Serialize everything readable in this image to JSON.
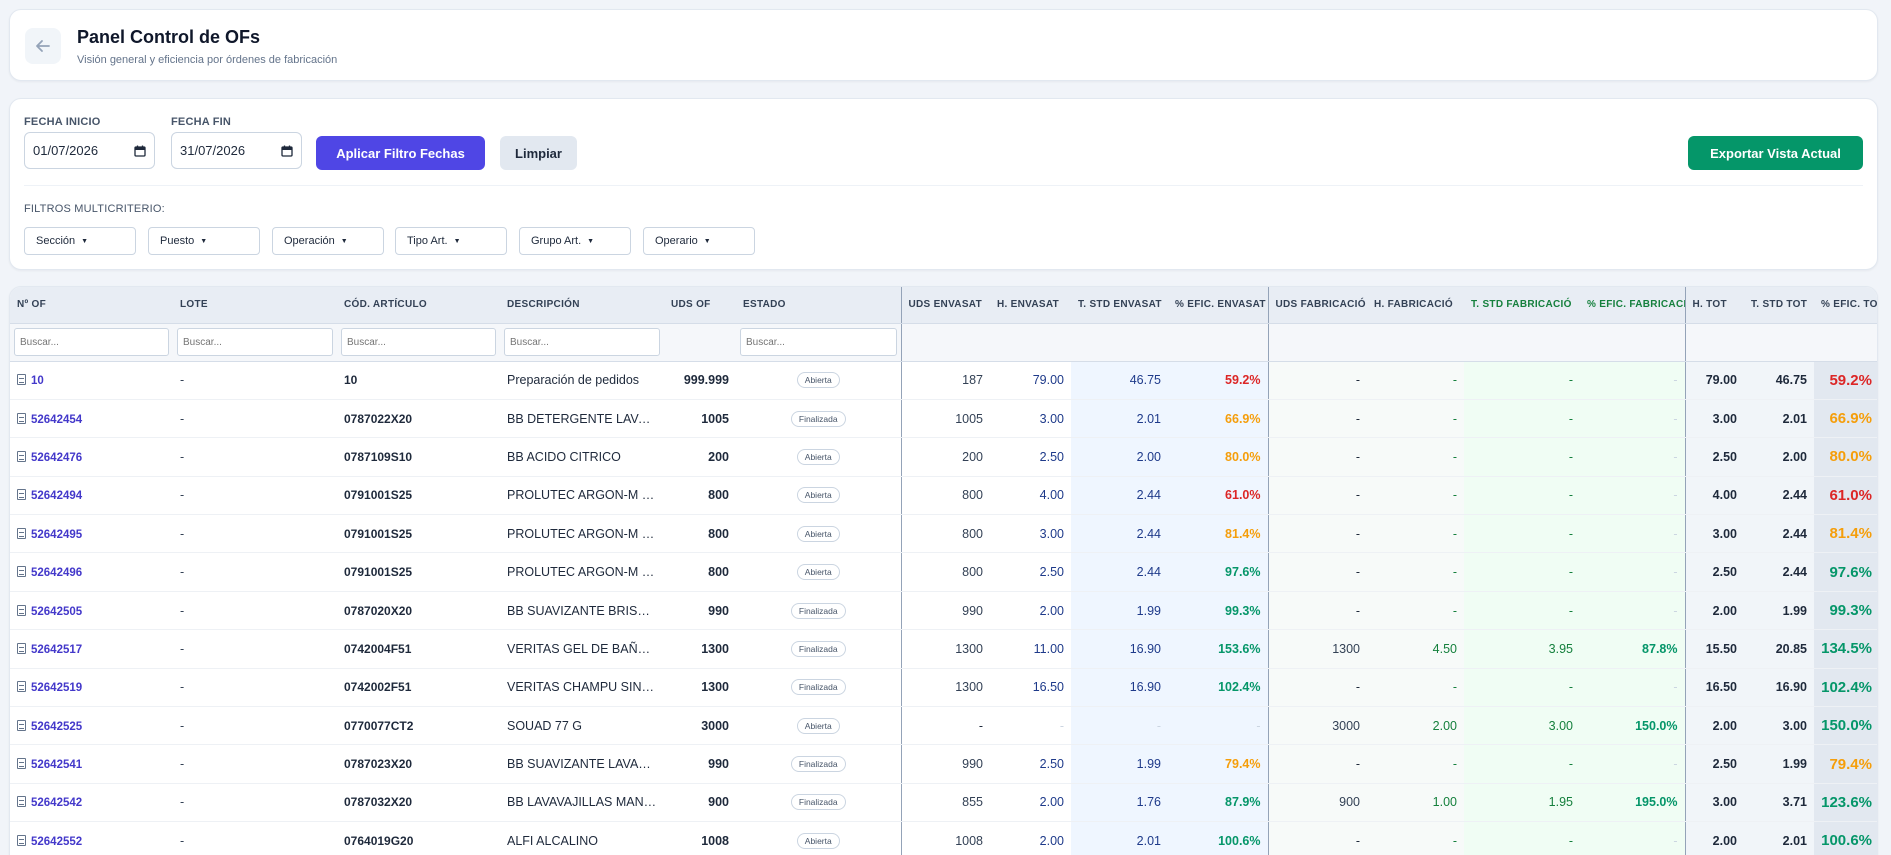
{
  "header": {
    "title": "Panel Control de OFs",
    "subtitle": "Visión general y eficiencia por órdenes de fabricación"
  },
  "filters": {
    "start_label": "FECHA INICIO",
    "start_value": "01/07/2026",
    "end_label": "FECHA FIN",
    "end_value": "31/07/2026",
    "apply_label": "Aplicar Filtro Fechas",
    "clear_label": "Limpiar",
    "export_label": "Exportar Vista Actual",
    "multi_label": "FILTROS MULTICRITERIO:",
    "dropdowns": [
      "Sección",
      "Puesto",
      "Operación",
      "Tipo Art.",
      "Grupo Art.",
      "Operario"
    ]
  },
  "colors": {
    "primary": "#4f46e5",
    "export": "#059669",
    "eff_low": "#dc2626",
    "eff_mid": "#f59e0b",
    "eff_high": "#059669"
  },
  "table": {
    "columns": [
      "Nº OF",
      "LOTE",
      "CÓD. ARTÍCULO",
      "DESCRIPCIÓN",
      "UDS OF",
      "ESTADO",
      "UDS ENVASAT",
      "H. ENVASAT",
      "T. STD ENVASAT",
      "% EFIC. ENVASAT",
      "UDS FABRICACIÓ",
      "H. FABRICACIÓ",
      "T. STD FABRICACIÓ",
      "% EFIC. FABRICACIÓ",
      "H. TOT",
      "T. STD TOT",
      "% EFIC. TOT"
    ],
    "search_placeholder": "Buscar...",
    "rows": [
      {
        "of": "10",
        "lote": "-",
        "cod": "10",
        "desc": "Preparación de pedidos",
        "uds": "999.999",
        "estado": "Abierta",
        "u_env": "187",
        "h_env": "79.00",
        "t_env": "46.75",
        "e_env": "59.2%",
        "e_env_lvl": "low",
        "u_fab": "-",
        "h_fab": "-",
        "t_fab": "-",
        "e_fab": "-",
        "e_fab_lvl": "none",
        "h_tot": "79.00",
        "t_tot": "46.75",
        "e_tot": "59.2%",
        "e_tot_lvl": "low"
      },
      {
        "of": "52642454",
        "lote": "-",
        "cod": "0787022X20",
        "desc": "BB DETERGENTE LAVADORA",
        "uds": "1005",
        "estado": "Finalizada",
        "u_env": "1005",
        "h_env": "3.00",
        "t_env": "2.01",
        "e_env": "66.9%",
        "e_env_lvl": "mid",
        "u_fab": "-",
        "h_fab": "-",
        "t_fab": "-",
        "e_fab": "-",
        "e_fab_lvl": "none",
        "h_tot": "3.00",
        "t_tot": "2.01",
        "e_tot": "66.9%",
        "e_tot_lvl": "mid"
      },
      {
        "of": "52642476",
        "lote": "-",
        "cod": "0787109S10",
        "desc": "BB ACIDO CITRICO",
        "uds": "200",
        "estado": "Abierta",
        "u_env": "200",
        "h_env": "2.50",
        "t_env": "2.00",
        "e_env": "80.0%",
        "e_env_lvl": "mid",
        "u_fab": "-",
        "h_fab": "-",
        "t_fab": "-",
        "e_fab": "-",
        "e_fab_lvl": "none",
        "h_tot": "2.50",
        "t_tot": "2.00",
        "e_tot": "80.0%",
        "e_tot_lvl": "mid"
      },
      {
        "of": "52642494",
        "lote": "-",
        "cod": "0791001S25",
        "desc": "PROLUTEC ARGON-M JABON",
        "uds": "800",
        "estado": "Abierta",
        "u_env": "800",
        "h_env": "4.00",
        "t_env": "2.44",
        "e_env": "61.0%",
        "e_env_lvl": "low",
        "u_fab": "-",
        "h_fab": "-",
        "t_fab": "-",
        "e_fab": "-",
        "e_fab_lvl": "none",
        "h_tot": "4.00",
        "t_tot": "2.44",
        "e_tot": "61.0%",
        "e_tot_lvl": "low"
      },
      {
        "of": "52642495",
        "lote": "-",
        "cod": "0791001S25",
        "desc": "PROLUTEC ARGON-M JABON",
        "uds": "800",
        "estado": "Abierta",
        "u_env": "800",
        "h_env": "3.00",
        "t_env": "2.44",
        "e_env": "81.4%",
        "e_env_lvl": "mid",
        "u_fab": "-",
        "h_fab": "-",
        "t_fab": "-",
        "e_fab": "-",
        "e_fab_lvl": "none",
        "h_tot": "3.00",
        "t_tot": "2.44",
        "e_tot": "81.4%",
        "e_tot_lvl": "mid"
      },
      {
        "of": "52642496",
        "lote": "-",
        "cod": "0791001S25",
        "desc": "PROLUTEC ARGON-M JABON",
        "uds": "800",
        "estado": "Abierta",
        "u_env": "800",
        "h_env": "2.50",
        "t_env": "2.44",
        "e_env": "97.6%",
        "e_env_lvl": "high",
        "u_fab": "-",
        "h_fab": "-",
        "t_fab": "-",
        "e_fab": "-",
        "e_fab_lvl": "none",
        "h_tot": "2.50",
        "t_tot": "2.44",
        "e_tot": "97.6%",
        "e_tot_lvl": "high"
      },
      {
        "of": "52642505",
        "lote": "-",
        "cod": "0787020X20",
        "desc": "BB SUAVIZANTE BRISA MARINA",
        "uds": "990",
        "estado": "Finalizada",
        "u_env": "990",
        "h_env": "2.00",
        "t_env": "1.99",
        "e_env": "99.3%",
        "e_env_lvl": "high",
        "u_fab": "-",
        "h_fab": "-",
        "t_fab": "-",
        "e_fab": "-",
        "e_fab_lvl": "none",
        "h_tot": "2.00",
        "t_tot": "1.99",
        "e_tot": "99.3%",
        "e_tot_lvl": "high"
      },
      {
        "of": "52642517",
        "lote": "-",
        "cod": "0742004F51",
        "desc": "VERITAS GEL DE BAÑO AVENA",
        "uds": "1300",
        "estado": "Finalizada",
        "u_env": "1300",
        "h_env": "11.00",
        "t_env": "16.90",
        "e_env": "153.6%",
        "e_env_lvl": "high",
        "u_fab": "1300",
        "h_fab": "4.50",
        "t_fab": "3.95",
        "e_fab": "87.8%",
        "e_fab_lvl": "high",
        "h_tot": "15.50",
        "t_tot": "20.85",
        "e_tot": "134.5%",
        "e_tot_lvl": "high"
      },
      {
        "of": "52642519",
        "lote": "-",
        "cod": "0742002F51",
        "desc": "VERITAS CHAMPU SIN SAL",
        "uds": "1300",
        "estado": "Finalizada",
        "u_env": "1300",
        "h_env": "16.50",
        "t_env": "16.90",
        "e_env": "102.4%",
        "e_env_lvl": "high",
        "u_fab": "-",
        "h_fab": "-",
        "t_fab": "-",
        "e_fab": "-",
        "e_fab_lvl": "none",
        "h_tot": "16.50",
        "t_tot": "16.90",
        "e_tot": "102.4%",
        "e_tot_lvl": "high"
      },
      {
        "of": "52642525",
        "lote": "-",
        "cod": "0770077CT2",
        "desc": "SOUAD 77 G",
        "uds": "3000",
        "estado": "Abierta",
        "u_env": "-",
        "h_env": "-",
        "t_env": "-",
        "e_env": "-",
        "e_env_lvl": "none",
        "u_fab": "3000",
        "h_fab": "2.00",
        "t_fab": "3.00",
        "e_fab": "150.0%",
        "e_fab_lvl": "high",
        "h_tot": "2.00",
        "t_tot": "3.00",
        "e_tot": "150.0%",
        "e_tot_lvl": "high"
      },
      {
        "of": "52642541",
        "lote": "-",
        "cod": "0787023X20",
        "desc": "BB SUAVIZANTE LAVANDA",
        "uds": "990",
        "estado": "Finalizada",
        "u_env": "990",
        "h_env": "2.50",
        "t_env": "1.99",
        "e_env": "79.4%",
        "e_env_lvl": "mid",
        "u_fab": "-",
        "h_fab": "-",
        "t_fab": "-",
        "e_fab": "-",
        "e_fab_lvl": "none",
        "h_tot": "2.50",
        "t_tot": "1.99",
        "e_tot": "79.4%",
        "e_tot_lvl": "mid"
      },
      {
        "of": "52642542",
        "lote": "-",
        "cod": "0787032X20",
        "desc": "BB LAVAVAJILLAS MANZANA",
        "uds": "900",
        "estado": "Finalizada",
        "u_env": "855",
        "h_env": "2.00",
        "t_env": "1.76",
        "e_env": "87.9%",
        "e_env_lvl": "high",
        "u_fab": "900",
        "h_fab": "1.00",
        "t_fab": "1.95",
        "e_fab": "195.0%",
        "e_fab_lvl": "high",
        "h_tot": "3.00",
        "t_tot": "3.71",
        "e_tot": "123.6%",
        "e_tot_lvl": "high"
      },
      {
        "of": "52642552",
        "lote": "-",
        "cod": "0764019G20",
        "desc": "ALFI ALCALINO",
        "uds": "1008",
        "estado": "Abierta",
        "u_env": "1008",
        "h_env": "2.00",
        "t_env": "2.01",
        "e_env": "100.6%",
        "e_env_lvl": "high",
        "u_fab": "-",
        "h_fab": "-",
        "t_fab": "-",
        "e_fab": "-",
        "e_fab_lvl": "none",
        "h_tot": "2.00",
        "t_tot": "2.01",
        "e_tot": "100.6%",
        "e_tot_lvl": "high"
      }
    ]
  }
}
